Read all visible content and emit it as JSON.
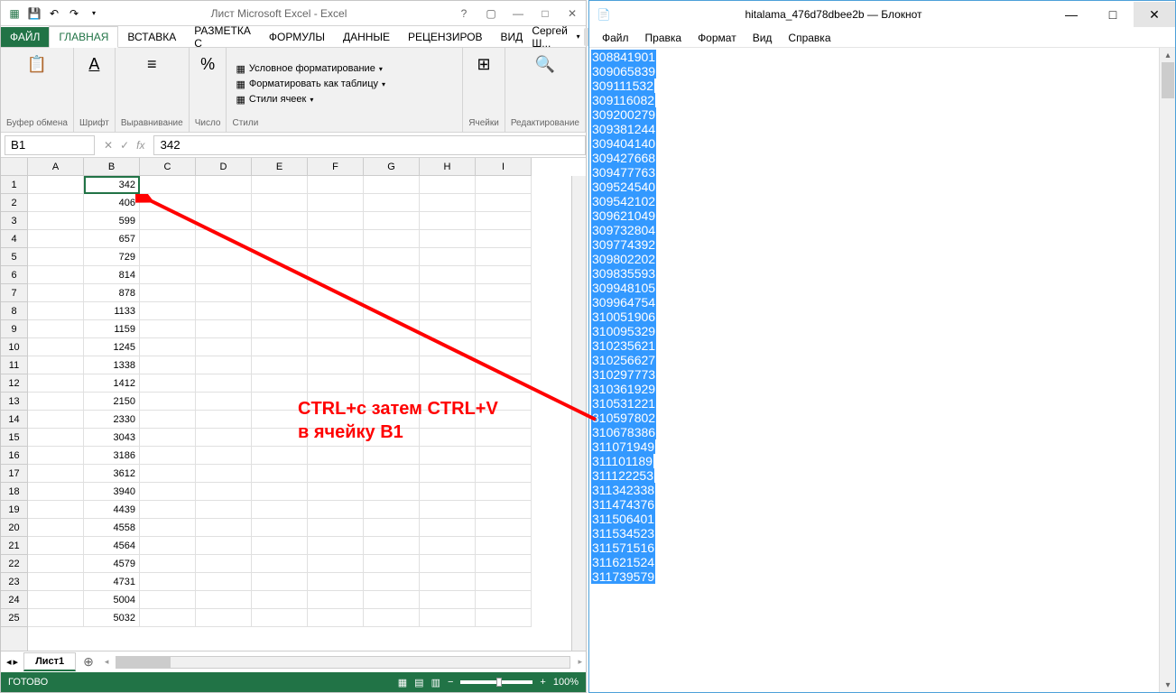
{
  "excel": {
    "title": "Лист Microsoft Excel - Excel",
    "tabs": {
      "file": "ФАЙЛ",
      "home": "ГЛАВНАЯ",
      "insert": "ВСТАВКА",
      "layout": "РАЗМЕТКА С",
      "formulas": "ФОРМУЛЫ",
      "data": "ДАННЫЕ",
      "review": "РЕЦЕНЗИРОВ",
      "view": "ВИД"
    },
    "user": "Сергей Ш...",
    "ribbon": {
      "clipboard": "Буфер обмена",
      "font": "Шрифт",
      "alignment": "Выравнивание",
      "number": "Число",
      "styles": "Стили",
      "cond_format": "Условное форматирование",
      "format_table": "Форматировать как таблицу",
      "cell_styles": "Стили ячеек",
      "cells": "Ячейки",
      "editing": "Редактирование"
    },
    "name_box": "B1",
    "formula": "342",
    "columns": [
      "A",
      "B",
      "C",
      "D",
      "E",
      "F",
      "G",
      "H",
      "I"
    ],
    "rows": [
      {
        "n": 1,
        "b": "342"
      },
      {
        "n": 2,
        "b": "406"
      },
      {
        "n": 3,
        "b": "599"
      },
      {
        "n": 4,
        "b": "657"
      },
      {
        "n": 5,
        "b": "729"
      },
      {
        "n": 6,
        "b": "814"
      },
      {
        "n": 7,
        "b": "878"
      },
      {
        "n": 8,
        "b": "1133"
      },
      {
        "n": 9,
        "b": "1159"
      },
      {
        "n": 10,
        "b": "1245"
      },
      {
        "n": 11,
        "b": "1338"
      },
      {
        "n": 12,
        "b": "1412"
      },
      {
        "n": 13,
        "b": "2150"
      },
      {
        "n": 14,
        "b": "2330"
      },
      {
        "n": 15,
        "b": "3043"
      },
      {
        "n": 16,
        "b": "3186"
      },
      {
        "n": 17,
        "b": "3612"
      },
      {
        "n": 18,
        "b": "3940"
      },
      {
        "n": 19,
        "b": "4439"
      },
      {
        "n": 20,
        "b": "4558"
      },
      {
        "n": 21,
        "b": "4564"
      },
      {
        "n": 22,
        "b": "4579"
      },
      {
        "n": 23,
        "b": "4731"
      },
      {
        "n": 24,
        "b": "5004"
      },
      {
        "n": 25,
        "b": "5032"
      }
    ],
    "sheet": "Лист1",
    "status": "ГОТОВО",
    "zoom": "100%"
  },
  "notepad": {
    "title": "hitalama_476d78dbee2b — Блокнот",
    "menu": {
      "file": "Файл",
      "edit": "Правка",
      "format": "Формат",
      "view": "Вид",
      "help": "Справка"
    },
    "lines": [
      "308841901",
      "309065839",
      "309111532",
      "309116082",
      "309200279",
      "309381244",
      "309404140",
      "309427668",
      "309477763",
      "309524540",
      "309542102",
      "309621049",
      "309732804",
      "309774392",
      "309802202",
      "309835593",
      "309948105",
      "309964754",
      "310051906",
      "310095329",
      "310235621",
      "310256627",
      "310297773",
      "310361929",
      "310531221",
      "310597802",
      "310678386",
      "311071949",
      "311101189",
      "311122253",
      "311342338",
      "311474376",
      "311506401",
      "311534523",
      "311571516",
      "311621524",
      "311739579"
    ]
  },
  "annotation": {
    "line1": "CTRL+с  затем CTRL+V",
    "line2": "в ячейку B1"
  }
}
